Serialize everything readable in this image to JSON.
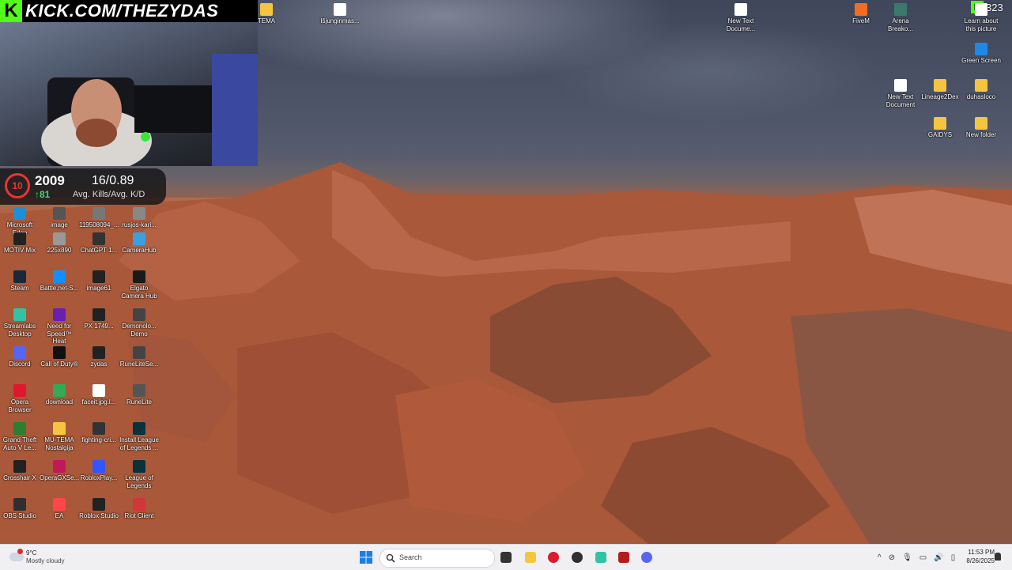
{
  "stream": {
    "logo_letter": "K",
    "url": "KICK.COM/THEZYDAS"
  },
  "stats": {
    "level": "10",
    "elo": "2009",
    "elo_change": "↑81",
    "kd": "16/0.89",
    "kd_label": "Avg. Kills/Avg. K/D"
  },
  "overlay_right": {
    "letter": "K",
    "count": "323"
  },
  "desktop_icons": [
    {
      "label": "Microsoft Edge",
      "icon": "edge-icon",
      "color": "#1b8fd8"
    },
    {
      "label": "image",
      "icon": "image-file-icon",
      "color": "#555"
    },
    {
      "label": "119508094_...",
      "icon": "image-file-icon",
      "color": "#777"
    },
    {
      "label": "rusjos-kari...",
      "icon": "image-file-icon",
      "color": "#888"
    },
    {
      "label": "MOTIV Mix",
      "icon": "motiv-mix-icon",
      "color": "#222"
    },
    {
      "label": "225x890",
      "icon": "image-file-icon",
      "color": "#999"
    },
    {
      "label": "ChatGPT 1...",
      "icon": "image-file-icon",
      "color": "#333"
    },
    {
      "label": "CameraHub",
      "icon": "camera-hub-icon",
      "color": "#3aa0e0"
    },
    {
      "label": "Steam",
      "icon": "steam-icon",
      "color": "#1b2838"
    },
    {
      "label": "Battle.net-S...",
      "icon": "battlenet-icon",
      "color": "#148eff"
    },
    {
      "label": "image61",
      "icon": "image-file-icon",
      "color": "#222"
    },
    {
      "label": "Elgato Camera Hub",
      "icon": "camera-hub-icon",
      "color": "#1a1a1a"
    },
    {
      "label": "Streamlabs Desktop",
      "icon": "streamlabs-icon",
      "color": "#31c3a2"
    },
    {
      "label": "Need for Speed™ Heat",
      "icon": "nfs-icon",
      "color": "#6a1fb0"
    },
    {
      "label": "PX 1749...",
      "icon": "image-file-icon",
      "color": "#222"
    },
    {
      "label": "Demonolo... Demo",
      "icon": "demonologist-icon",
      "color": "#444"
    },
    {
      "label": "Discord",
      "icon": "discord-icon",
      "color": "#5865f2"
    },
    {
      "label": "Call of Duty®",
      "icon": "cod-icon",
      "color": "#111"
    },
    {
      "label": "zydas",
      "icon": "image-file-icon",
      "color": "#222"
    },
    {
      "label": "RuneLiteSe...",
      "icon": "runelite-icon",
      "color": "#444"
    },
    {
      "label": "Opera Browser",
      "icon": "opera-icon",
      "color": "#e0182d"
    },
    {
      "label": "download",
      "icon": "image-file-icon",
      "color": "#3a5"
    },
    {
      "label": "faceit.jpg.l...",
      "icon": "text-file-icon",
      "color": "#fff"
    },
    {
      "label": "RuneLite",
      "icon": "runelite-icon",
      "color": "#555"
    },
    {
      "label": "Grand Theft Auto V Le...",
      "icon": "gta-icon",
      "color": "#2e7d32"
    },
    {
      "label": "MU-TEMA Nostalgija",
      "icon": "folder-icon",
      "color": "#f5c542"
    },
    {
      "label": "fighting-cri...",
      "icon": "image-file-icon",
      "color": "#333"
    },
    {
      "label": "Install League of Legends ...",
      "icon": "league-icon",
      "color": "#0a323c"
    },
    {
      "label": "Crosshair X",
      "icon": "crosshair-icon",
      "color": "#222"
    },
    {
      "label": "OperaGXSe...",
      "icon": "opera-gx-icon",
      "color": "#c2185b"
    },
    {
      "label": "RobloxPlay...",
      "icon": "roblox-icon",
      "color": "#3355ff"
    },
    {
      "label": "League of Legends",
      "icon": "league-icon",
      "color": "#0a323c"
    },
    {
      "label": "OBS Studio",
      "icon": "obs-icon",
      "color": "#302e31"
    },
    {
      "label": "EA",
      "icon": "ea-icon",
      "color": "#ff4747"
    },
    {
      "label": "Roblox Studio",
      "icon": "roblox-studio-icon",
      "color": "#222"
    },
    {
      "label": "Riot Client",
      "icon": "riot-icon",
      "color": "#d13639"
    }
  ],
  "top_icons": [
    {
      "label": "TEMA",
      "icon": "folder-icon",
      "color": "#f5c542"
    },
    {
      "label": "Išjunginmas...",
      "icon": "text-file-icon",
      "color": "#fff"
    },
    {
      "label": "New Text Docume...",
      "icon": "text-file-icon",
      "color": "#fff"
    },
    {
      "label": "FiveM",
      "icon": "fivem-icon",
      "color": "#f36d21"
    },
    {
      "label": "Arena Breako...",
      "icon": "arena-breakout-icon",
      "color": "#3a7a6a"
    },
    {
      "label": "Learn about this picture",
      "icon": "learn-picture-icon",
      "color": "#ffffff"
    },
    {
      "label": "Green Screen",
      "icon": "green-screen-icon",
      "color": "#1e88e5"
    },
    {
      "label": "New Text Document",
      "icon": "text-file-icon",
      "color": "#fff"
    },
    {
      "label": "Lineage2Dex",
      "icon": "folder-icon",
      "color": "#f5c542"
    },
    {
      "label": "duhasloco",
      "icon": "folder-icon",
      "color": "#f5c542"
    },
    {
      "label": "GAIDYS",
      "icon": "folder-icon",
      "color": "#f5c542"
    },
    {
      "label": "New folder",
      "icon": "folder-icon",
      "color": "#f5c542"
    }
  ],
  "taskbar": {
    "weather_temp": "9°C",
    "weather_desc": "Mostly cloudy",
    "search_placeholder": "Search",
    "apps": [
      {
        "name": "task-view-icon",
        "color": "#333"
      },
      {
        "name": "file-explorer-icon",
        "color": "#f5c542"
      },
      {
        "name": "opera-icon",
        "color": "#e0182d"
      },
      {
        "name": "obs-icon",
        "color": "#302e31"
      },
      {
        "name": "streamlabs-icon",
        "color": "#31c3a2"
      },
      {
        "name": "shield-game-icon",
        "color": "#b71c1c"
      },
      {
        "name": "discord-icon",
        "color": "#5865f2"
      }
    ],
    "time": "11:53 PM",
    "date": "8/26/2025"
  }
}
